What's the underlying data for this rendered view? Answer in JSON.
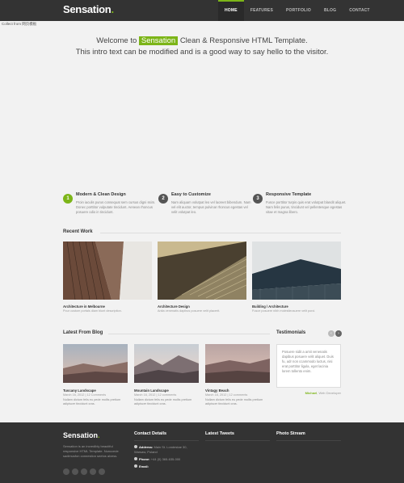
{
  "header": {
    "logo": "Sensation",
    "logo_dot": ".",
    "nav": [
      "HOME",
      "FEATURES",
      "PORTFOLIO",
      "BLOG",
      "CONTACT"
    ]
  },
  "collect_note": "Collect from 网页模板",
  "intro": {
    "prefix": "Welcome to",
    "highlight": "Sensation",
    "suffix": "Clean & Responsive HTML Template.",
    "line2": "This intro text can be modified and is a good way to say hello to the visitor."
  },
  "features": [
    {
      "num": "1",
      "title": "Modern & Clean Design",
      "text": "Proin iaculis purus consequat sem cursus digni ssim. Donec porttitor vulputate tincidunt. Aenean rhoncus posuere odio in tincidunt."
    },
    {
      "num": "2",
      "title": "Easy to Customize",
      "text": "Nam aliquam volutpat leo vel laoreet bibendum. Nam vel elit auctor, tempus pulvinar rhoncus egestas vel velit volutpat leo."
    },
    {
      "num": "3",
      "title": "Responsive Template",
      "text": "Fusce porttitor turpis quis erat volutpat blandit aliquet. Nam felis purus, tincidunt vel pellentesque egestas vitae et magna libero."
    }
  ],
  "recent_work": {
    "title": "Recent Work",
    "items": [
      {
        "caption": "Architecture in Melbourne",
        "desc": "Pour custom portals diam blunt description."
      },
      {
        "caption": "Architecture Design",
        "desc": "Anita venenatis dapibus posuere velit placerit."
      },
      {
        "caption": "Building / Architecture",
        "desc": "Fusce posuere nibh molestieosuere velit porci."
      }
    ]
  },
  "blog": {
    "title": "Latest From Blog",
    "items": [
      {
        "title": "Tuscany Landscape",
        "meta": "March 16, 2012 | 12 Comments",
        "text": "Nullam dictum felis eu pede mollis pretium adipiscer tincidunt cras."
      },
      {
        "title": "Mountain Landscape",
        "meta": "March 16, 2012 | 12 comments",
        "text": "Nullam dictum felis eu pede mollis pretium adipiscer tincidunt cras."
      },
      {
        "title": "Vintagy Beach",
        "meta": "March 16, 2012 | 12 comments",
        "text": "Nullam dictum felis eu pede mollis pretium adipiscer tincidunt cras."
      }
    ]
  },
  "testimonials": {
    "title": "Testimonials",
    "quote": "Posuere sidit a amit venenatis dapibus posuere velit aliquet. Duis fu, adr non ccammodo luctus, nisi erat porttitor ligula, eget lacinia lorem tollento enim.",
    "author": "Michael",
    "company": ", Web Developer"
  },
  "footer": {
    "logo": "Sensation",
    "logo_dot": ".",
    "about": "Sensation is an incredibly beautiful responsive HTML Template. Nunccede sadimusfon connestion seetos alvess.",
    "contact_title": "Contact Details",
    "address_label": "Address:",
    "address": "Main St. Londestae 30, Warsaw, Poland",
    "phone_label": "Phone:",
    "phone": "+44 (0) 365-635-000",
    "email_label": "Email:",
    "tweets_title": "Latest Tweets",
    "photo_title": "Photo Stream"
  },
  "colors": {
    "accent": "#7cb518",
    "header_bg": "#333333",
    "body_bg": "#f2f2f2"
  }
}
